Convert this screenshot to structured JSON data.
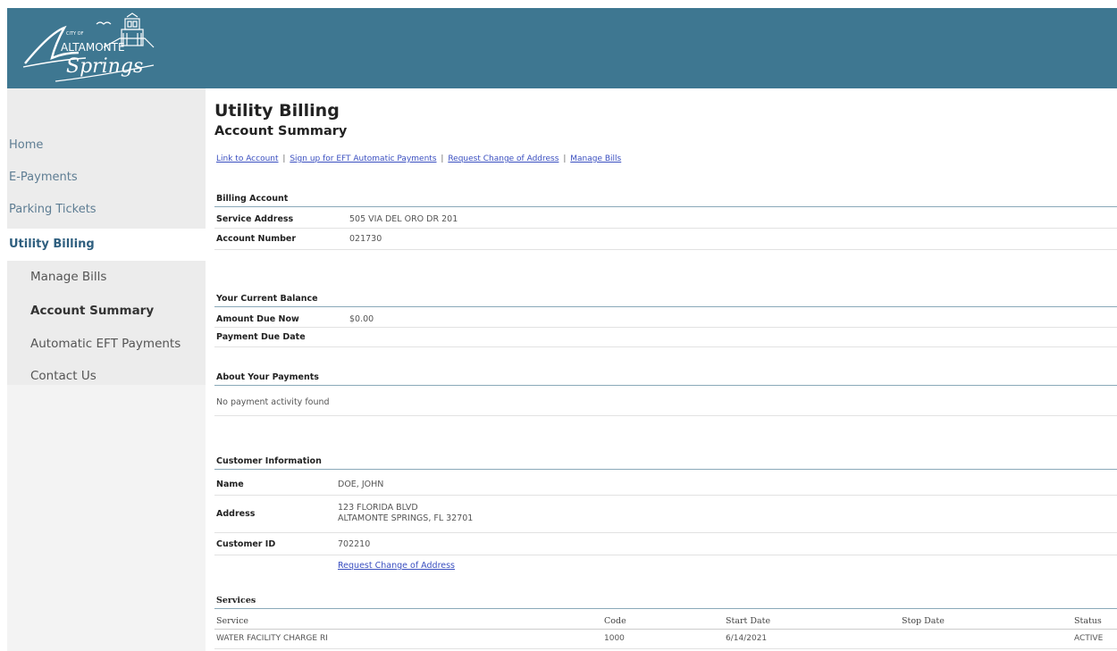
{
  "logo": {
    "small_text": "CITY OF",
    "word1": "ALTAMONTE",
    "word2": "Springs"
  },
  "nav": {
    "items": [
      {
        "label": "Home"
      },
      {
        "label": "E-Payments"
      },
      {
        "label": "Parking Tickets"
      },
      {
        "label": "Utility Billing"
      }
    ],
    "sub_items": [
      {
        "label": "Manage Bills"
      },
      {
        "label": "Account Summary"
      },
      {
        "label": "Automatic EFT Payments"
      },
      {
        "label": "Contact Us"
      }
    ]
  },
  "page": {
    "title": "Utility Billing",
    "subtitle": "Account Summary"
  },
  "links": {
    "link_account": "Link to Account",
    "eft_signup": "Sign up for EFT Automatic Payments",
    "change_address": "Request Change of Address",
    "manage_bills": "Manage Bills",
    "separator": "|"
  },
  "billing_account": {
    "heading": "Billing Account",
    "service_address_label": "Service Address",
    "service_address": "505 VIA DEL ORO DR 201",
    "account_number_label": "Account Number",
    "account_number": "021730"
  },
  "balance": {
    "heading": "Your Current Balance",
    "amount_due_label": "Amount Due Now",
    "amount_due": "$0.00",
    "due_date_label": "Payment Due Date",
    "due_date": ""
  },
  "payments": {
    "heading": "About Your Payments",
    "empty_text": "No payment activity found"
  },
  "customer": {
    "heading": "Customer Information",
    "name_label": "Name",
    "name": "DOE, JOHN",
    "address_label": "Address",
    "address_line1": "123 FLORIDA BLVD",
    "address_line2": "ALTAMONTE SPRINGS, FL 32701",
    "id_label": "Customer ID",
    "id": "702210",
    "change_address_link": "Request Change of Address"
  },
  "services": {
    "heading": "Services",
    "columns": [
      "Service",
      "Code",
      "Start Date",
      "Stop Date",
      "Status"
    ],
    "rows": [
      [
        "WATER FACILITY CHARGE RI",
        "1000",
        "6/14/2021",
        "",
        "ACTIVE"
      ]
    ]
  },
  "colors": {
    "banner": "#3e7791",
    "nav_text": "#5e7d93",
    "link": "#3a4fc0"
  }
}
